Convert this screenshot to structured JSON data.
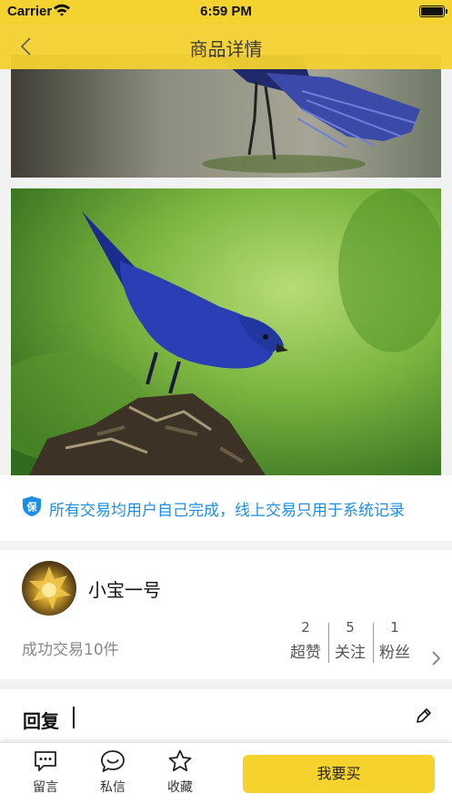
{
  "status_bar": {
    "carrier": "Carrier",
    "time": "6:59 PM"
  },
  "nav": {
    "title": "商品详情",
    "icon": "chevron-left-icon"
  },
  "colors": {
    "brand": "#f4d230",
    "notice": "#1b8fe8",
    "buy_button": "#f6d32c"
  },
  "notice": {
    "badge_text": "保",
    "text": "所有交易均用户自己完成，线上交易只用于系统记录"
  },
  "seller": {
    "name": "小宝一号",
    "trade_count": "成功交易10件",
    "stats": [
      {
        "value": "2",
        "label": "超赞"
      },
      {
        "value": "5",
        "label": "关注"
      },
      {
        "value": "1",
        "label": "粉丝"
      }
    ]
  },
  "reply": {
    "title": "回复",
    "icon": "pencil-icon"
  },
  "bottom_bar": {
    "tools": [
      {
        "label": "留言",
        "icon": "message-icon"
      },
      {
        "label": "私信",
        "icon": "chat-bubble-icon"
      },
      {
        "label": "收藏",
        "icon": "star-icon"
      }
    ],
    "buy_label": "我要买"
  }
}
